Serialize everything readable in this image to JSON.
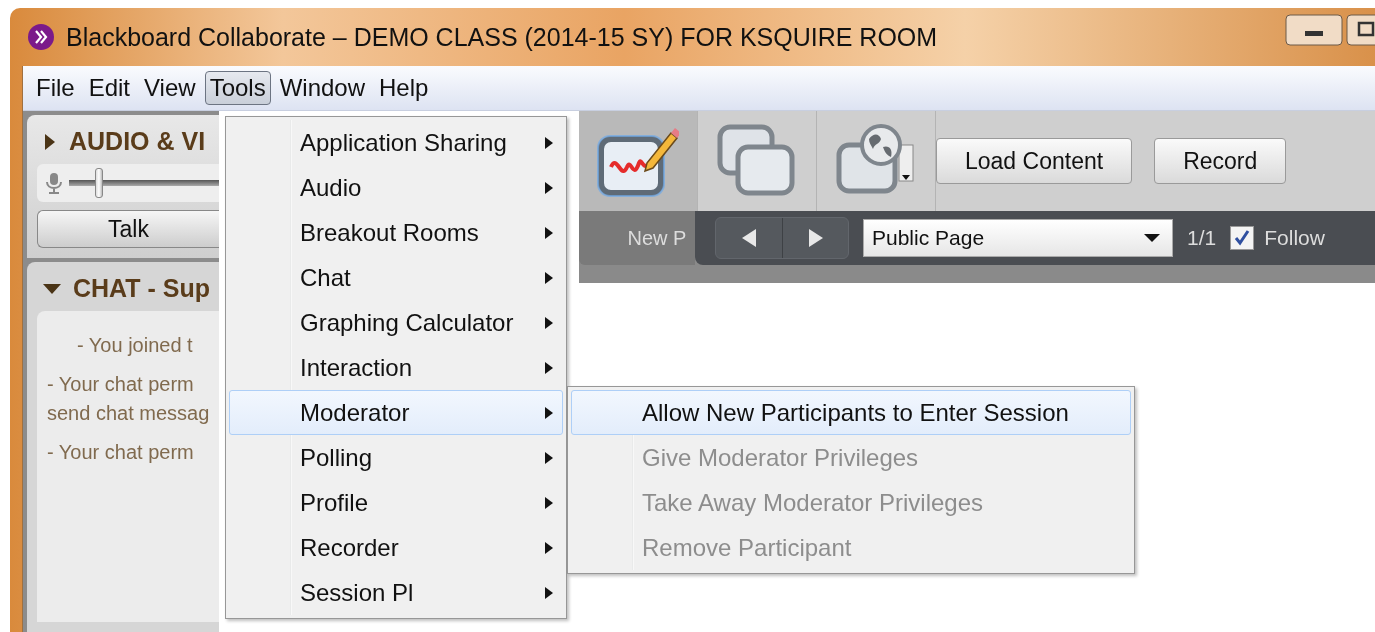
{
  "window": {
    "title": "Blackboard Collaborate – DEMO CLASS (2014-15 SY) FOR KSQUIRE ROOM"
  },
  "menu_bar": [
    {
      "label": "File",
      "selected": false
    },
    {
      "label": "Edit",
      "selected": false
    },
    {
      "label": "View",
      "selected": false
    },
    {
      "label": "Tools",
      "selected": true
    },
    {
      "label": "Window",
      "selected": false
    },
    {
      "label": "Help",
      "selected": false
    }
  ],
  "audio_panel": {
    "title": "AUDIO & VI",
    "expanded": false,
    "mic_slider": {
      "level": 0.2
    },
    "talk_button": "Talk"
  },
  "chat_panel": {
    "title": "CHAT - Sup",
    "expanded": true,
    "messages": [
      {
        "kind": "centered",
        "lines": [
          "- You joined t"
        ]
      },
      {
        "kind": "plain",
        "lines": [
          "- Your chat perm",
          "send chat messag"
        ]
      },
      {
        "kind": "plain",
        "lines": [
          "- Your chat perm"
        ]
      }
    ]
  },
  "toolbar": {
    "tools": [
      {
        "kind": "whiteboard",
        "selected": true
      },
      {
        "kind": "app_share",
        "selected": false
      },
      {
        "kind": "web_tour",
        "selected": false
      }
    ],
    "buttons": [
      "Load Content",
      "Record"
    ]
  },
  "page_bar": {
    "tab": "New P",
    "page_select": "Public Page",
    "page_count": "1/1",
    "follow": {
      "label": "Follow",
      "checked": true
    }
  },
  "tools_menu": {
    "items": [
      {
        "label": "Application Sharing",
        "selected": false
      },
      {
        "label": "Audio",
        "selected": false
      },
      {
        "label": "Breakout Rooms",
        "selected": false
      },
      {
        "label": "Chat",
        "selected": false
      },
      {
        "label": "Graphing Calculator",
        "selected": false
      },
      {
        "label": "Interaction",
        "selected": false
      },
      {
        "label": "Moderator",
        "selected": true
      },
      {
        "label": "Polling",
        "selected": false
      },
      {
        "label": "Profile",
        "selected": false
      },
      {
        "label": "Recorder",
        "selected": false
      },
      {
        "label": "Session Pl",
        "selected": false
      }
    ]
  },
  "moderator_submenu": {
    "items": [
      {
        "label": "Allow New Participants to Enter Session",
        "selected": true,
        "disabled": false
      },
      {
        "label": "Give Moderator Privileges",
        "selected": false,
        "disabled": true
      },
      {
        "label": "Take Away Moderator Privileges",
        "selected": false,
        "disabled": true
      },
      {
        "label": "Remove Participant",
        "selected": false,
        "disabled": true
      }
    ]
  }
}
